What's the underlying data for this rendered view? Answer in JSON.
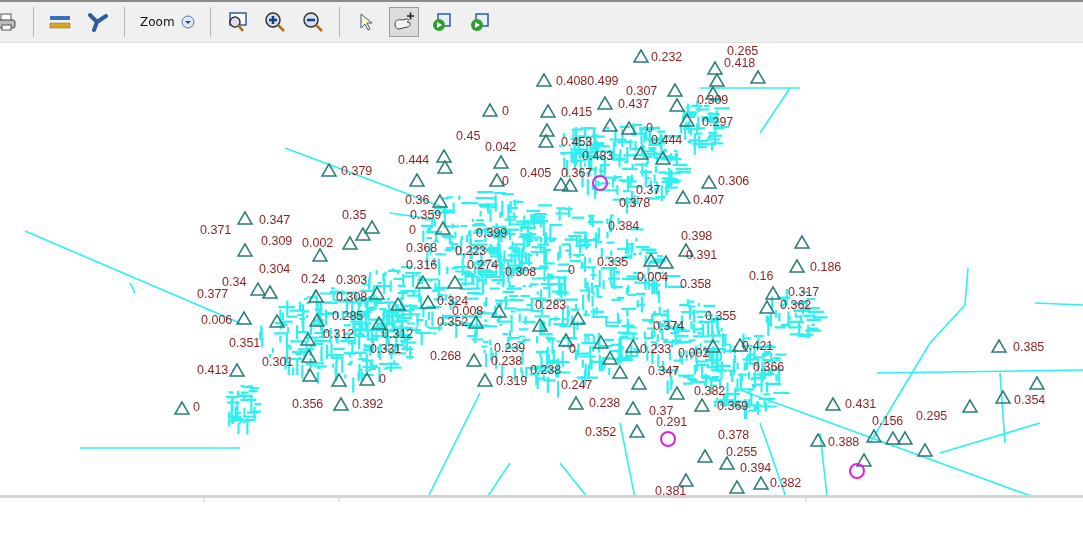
{
  "toolbar": {
    "tools": [
      {
        "kind": "print",
        "selected": false
      },
      {
        "kind": "measure",
        "selected": false
      },
      {
        "kind": "trace",
        "selected": false
      },
      {
        "kind": "zoom-menu",
        "label": "Zoom",
        "selected": false
      },
      {
        "kind": "zoom-window",
        "selected": false
      },
      {
        "kind": "zoom-in",
        "selected": false
      },
      {
        "kind": "zoom-out",
        "selected": false
      },
      {
        "kind": "select",
        "selected": false
      },
      {
        "kind": "pan-add",
        "selected": true
      },
      {
        "kind": "run",
        "selected": false
      },
      {
        "kind": "run",
        "selected": false
      }
    ]
  },
  "map": {
    "labels": [
      "0.232",
      "0.265",
      "0.418",
      "0.4080.499",
      "0.307",
      "0.309",
      "0",
      "0.415",
      "0.437",
      "0.297",
      "0.45",
      "0.042",
      "0.453",
      "0",
      "0.444",
      "0.444",
      "0.483",
      "0.379",
      "0.405",
      "0.367",
      "0",
      "0.306",
      "0.37",
      "0.36",
      "0.378",
      "0.407",
      "0.347",
      "0.35",
      "0.359",
      "0.371",
      "0",
      "0.399",
      "0.384",
      "0.398",
      "0.309",
      "0.002",
      "0.368",
      "0.223",
      "0.391",
      "0.304",
      "0.316",
      "0.274",
      "0.308",
      "0",
      "0.335",
      "0.186",
      "0.34",
      "0.24",
      "0.303",
      "0.004",
      "0.358",
      "0.16",
      "0.377",
      "0.317",
      "0.308",
      "0.324",
      "0.283",
      "0.362",
      "0.006",
      "0.285",
      "0.352",
      "0.008",
      "0.355",
      "0.374",
      "0.312",
      "0.312",
      "0.351",
      "0.331",
      "0.268",
      "0.239",
      "0",
      "0.233",
      "0.002",
      "0.421",
      "0.385",
      "0.413",
      "0.301",
      "0.238",
      "0.238",
      "0.347",
      "0.366",
      "0",
      "0.319",
      "0.247",
      "0.382",
      "0",
      "0.356",
      "0.392",
      "0.238",
      "0.369",
      "0.431",
      "0.354",
      "0.37",
      "0.291",
      "0.156",
      "0.295",
      "0.352",
      "0.378",
      "0.388",
      "0.255",
      "0.394",
      "0.382",
      "0.381"
    ]
  }
}
